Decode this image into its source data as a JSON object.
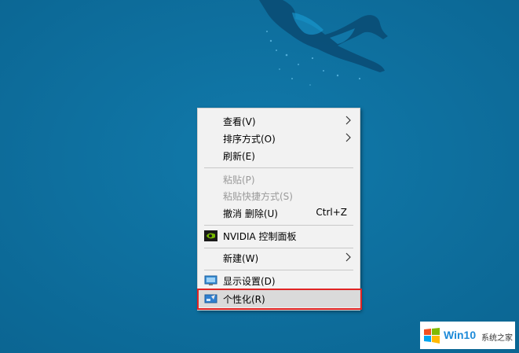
{
  "menu": {
    "items": [
      {
        "label": "查看(V)",
        "submenu": true
      },
      {
        "label": "排序方式(O)",
        "submenu": true
      },
      {
        "label": "刷新(E)"
      },
      {
        "label": "粘贴(P)",
        "disabled": true
      },
      {
        "label": "粘贴快捷方式(S)",
        "disabled": true
      },
      {
        "label": "撤消 删除(U)",
        "shortcut": "Ctrl+Z"
      },
      {
        "label": "NVIDIA 控制面板",
        "icon": "nvidia-icon"
      },
      {
        "label": "新建(W)",
        "submenu": true
      },
      {
        "label": "显示设置(D)",
        "icon": "display-settings-icon"
      },
      {
        "label": "个性化(R)",
        "icon": "personalize-icon",
        "highlighted": true
      }
    ]
  },
  "watermark": {
    "brand": "Win10",
    "subtitle": "系统之家",
    "logo": "windows-logo-icon"
  },
  "colors": {
    "desktop_bg": "#0e6f9e",
    "menu_bg": "#f2f2f2",
    "highlight_box": "#e02424"
  }
}
